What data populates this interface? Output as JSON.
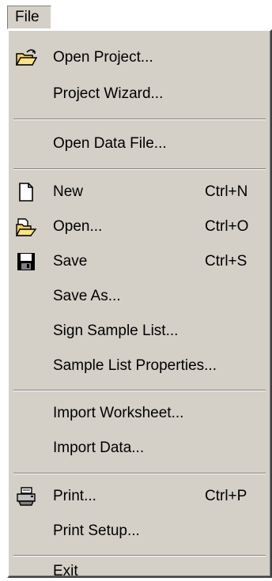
{
  "menubar": {
    "file_label": "File"
  },
  "menu": {
    "items": [
      {
        "label": "Open Project...",
        "shortcut": "",
        "icon": "open-project-icon"
      },
      {
        "label": "Project Wizard...",
        "shortcut": ""
      },
      {
        "label": "Open Data File...",
        "shortcut": ""
      },
      {
        "label": "New",
        "shortcut": "Ctrl+N",
        "icon": "new-document-icon"
      },
      {
        "label": "Open...",
        "shortcut": "Ctrl+O",
        "icon": "open-file-icon"
      },
      {
        "label": "Save",
        "shortcut": "Ctrl+S",
        "icon": "save-floppy-icon"
      },
      {
        "label": "Save As...",
        "shortcut": ""
      },
      {
        "label": "Sign Sample List...",
        "shortcut": ""
      },
      {
        "label": "Sample List Properties...",
        "shortcut": ""
      },
      {
        "label": "Import Worksheet...",
        "shortcut": ""
      },
      {
        "label": "Import Data...",
        "shortcut": ""
      },
      {
        "label": "Print...",
        "shortcut": "Ctrl+P",
        "icon": "printer-icon"
      },
      {
        "label": "Print Setup...",
        "shortcut": ""
      },
      {
        "label": "Exit",
        "shortcut": ""
      }
    ]
  },
  "colors": {
    "menu_face": "#d4d0c8",
    "separator_dark": "#808080",
    "separator_light": "#ffffff",
    "text": "#000000"
  }
}
